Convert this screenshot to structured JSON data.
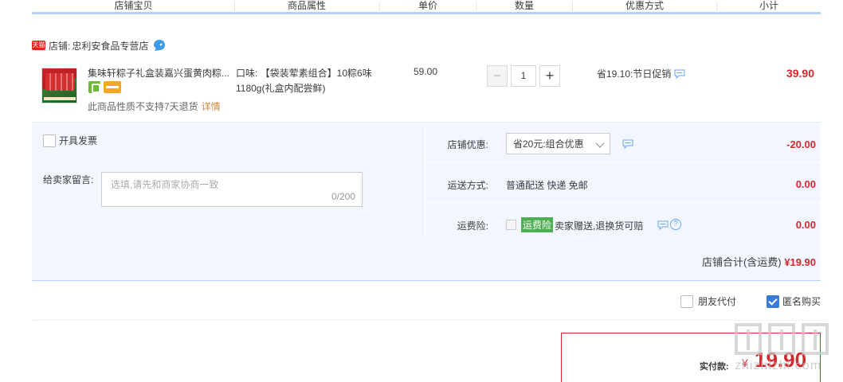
{
  "table_header": {
    "columns": [
      "店铺宝贝",
      "商品属性",
      "单价",
      "数量",
      "优惠方式",
      "小计"
    ]
  },
  "shop": {
    "badge": "天猫",
    "label": "店铺:",
    "name": "忠利安食品专营店"
  },
  "item": {
    "title": "集味轩粽子礼盒装嘉兴蛋黄肉粽...",
    "return_note": "此商品性质不支持7天退货",
    "detail_link": "详情",
    "property": "口味: 【袋装荤素组合】10粽6味 1180g(礼盒内配尝鲜)",
    "price": "59.00",
    "quantity": "1",
    "qty_minus": "−",
    "qty_plus": "+",
    "promotion": "省19.10:节日促销",
    "subtotal": "39.90"
  },
  "invoice": {
    "label": "开具发票"
  },
  "message": {
    "label": "给卖家留言:",
    "placeholder": "选填,请先和商家协商一致",
    "counter": "0/200"
  },
  "store_discount": {
    "label": "店铺优惠:",
    "selected": "省20元:组合优惠",
    "amount": "-20.00"
  },
  "shipping": {
    "label": "运送方式:",
    "value": "普通配送 快递 免邮",
    "amount": "0.00"
  },
  "insurance": {
    "label": "运费险:",
    "badge": "运费险",
    "text": "卖家赠送,退换货可赔",
    "amount": "0.00"
  },
  "store_total": {
    "label": "店铺合计(含运费)",
    "amount": "¥19.90"
  },
  "options": {
    "friend_pay": "朋友代付",
    "anonymous": "匿名购买"
  },
  "payment": {
    "label": "实付款:",
    "currency": "¥",
    "amount": "19.90"
  },
  "watermark": {
    "text": "zhizhizhi.com"
  },
  "colors": {
    "accent_red": "#d4282d",
    "header_line": "#b2d1ff",
    "panel_bg": "#f1f6ff",
    "checkbox_blue": "#3a7bd5"
  }
}
